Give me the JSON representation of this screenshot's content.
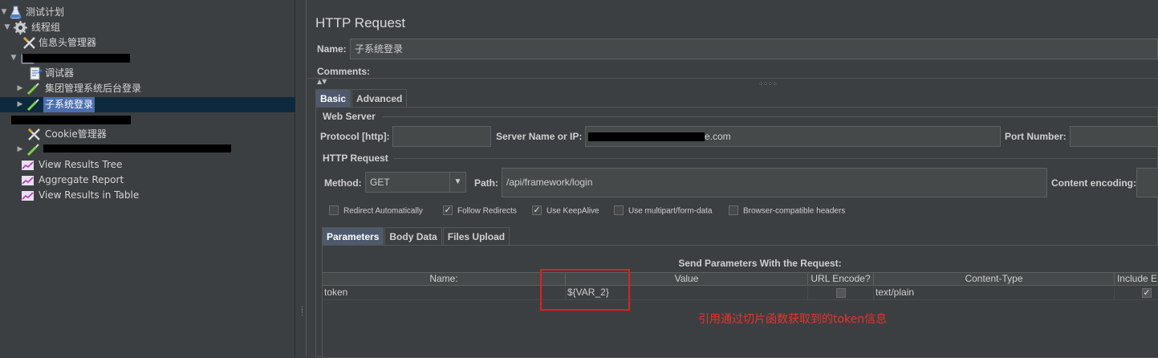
{
  "tree": {
    "items": [
      {
        "label": "测试计划",
        "icon": "flask-icon"
      },
      {
        "label": "线程组",
        "icon": "gear-icon"
      },
      {
        "label": "信息头管理器",
        "icon": "tools-icon"
      },
      {
        "label": "",
        "icon": "folder-icon"
      },
      {
        "label": "调试器",
        "icon": "script-icon"
      },
      {
        "label": "集团管理系统后台登录",
        "icon": "pipette-icon"
      },
      {
        "label": "子系统登录",
        "icon": "pipette-icon"
      },
      {
        "label": "",
        "icon": "folder-icon"
      },
      {
        "label": "Cookie管理器",
        "icon": "tools-icon"
      },
      {
        "label": "",
        "icon": "pipette-icon"
      },
      {
        "label": "View Results Tree",
        "icon": "graph-icon"
      },
      {
        "label": "Aggregate Report",
        "icon": "graph-icon"
      },
      {
        "label": "View Results in Table",
        "icon": "graph-icon"
      }
    ]
  },
  "panel": {
    "title": "HTTP Request",
    "name_label": "Name:",
    "name_value": "子系统登录",
    "comments_label": "Comments:"
  },
  "tabs": [
    "Basic",
    "Advanced"
  ],
  "web_server": {
    "title": "Web Server",
    "protocol_label": "Protocol [http]:",
    "protocol_value": "",
    "server_label": "Server Name or IP:",
    "server_value": "e.com",
    "port_label": "Port Number:",
    "port_value": ""
  },
  "http_request": {
    "title": "HTTP Request",
    "method_label": "Method:",
    "method_value": "GET",
    "path_label": "Path:",
    "path_value": "/api/framework/login",
    "encoding_label": "Content encoding:",
    "encoding_value": ""
  },
  "checkboxes": [
    {
      "label": "Redirect Automatically",
      "checked": false
    },
    {
      "label": "Follow Redirects",
      "checked": true
    },
    {
      "label": "Use KeepAlive",
      "checked": true
    },
    {
      "label": "Use multipart/form-data",
      "checked": false
    },
    {
      "label": "Browser-compatible headers",
      "checked": false
    }
  ],
  "subtabs": [
    "Parameters",
    "Body Data",
    "Files Upload"
  ],
  "params": {
    "caption": "Send Parameters With the Request:",
    "columns": [
      "Name:",
      "Value",
      "URL Encode?",
      "Content-Type",
      "Include E"
    ],
    "rows": [
      {
        "name": "token",
        "value": "${VAR_2}",
        "url_encode": false,
        "content_type": "text/plain",
        "include": true
      }
    ]
  },
  "annotation": "引用通过切片函数获取到的token信息",
  "colors": {
    "background": "#3c3f41",
    "selection": "#4b6eaf",
    "annotation": "#e8322c"
  }
}
